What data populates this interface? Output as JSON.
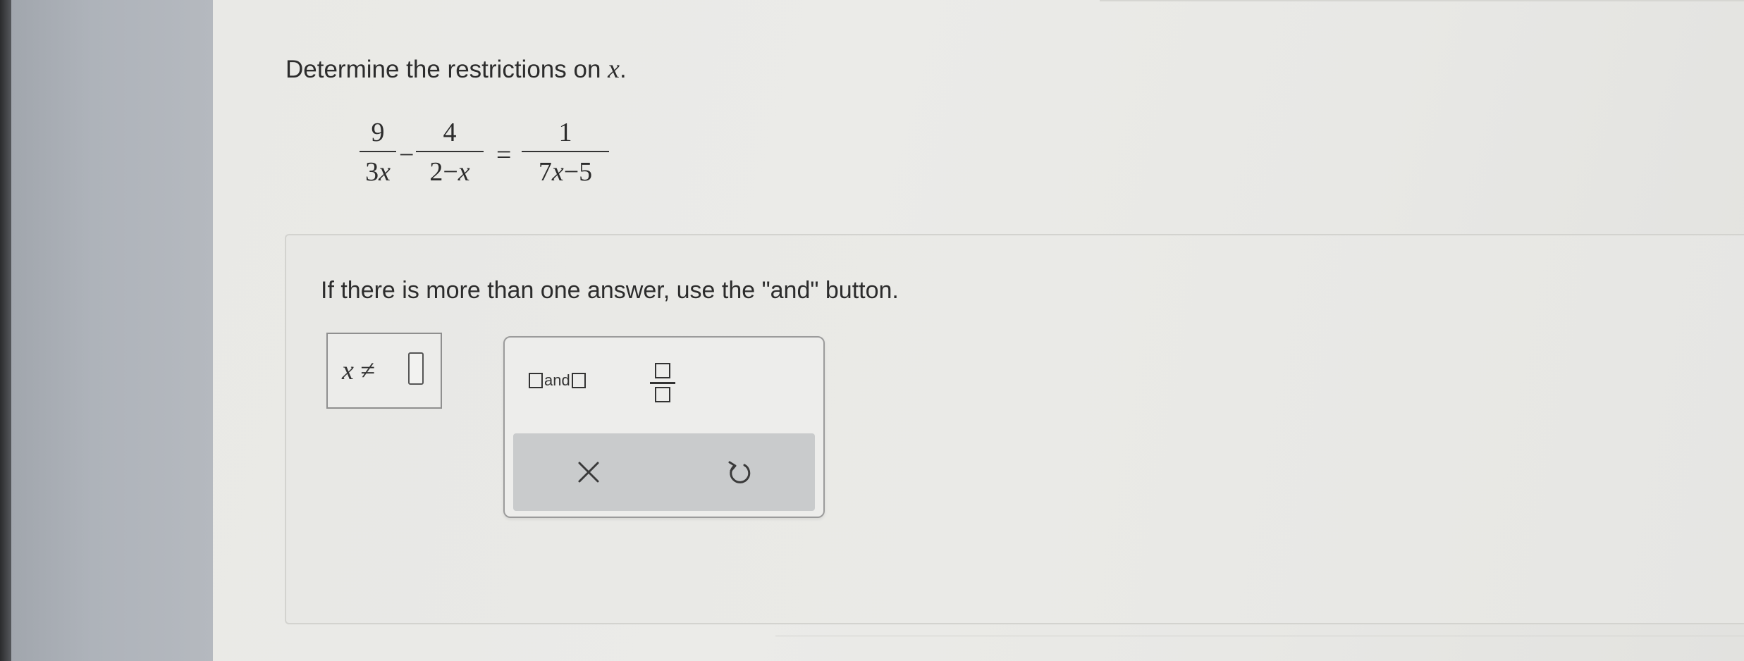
{
  "question": {
    "prompt_text": "Determine the restrictions on ",
    "prompt_variable": "x",
    "prompt_period": ".",
    "equation": {
      "term1": {
        "numerator": "9",
        "denominator_coef": "3",
        "denominator_var": "x"
      },
      "operator1": "−",
      "term2": {
        "numerator": "4",
        "denominator_left": "2−",
        "denominator_var": "x"
      },
      "equals": "=",
      "term3": {
        "numerator": "1",
        "denominator_coef": "7",
        "denominator_var": "x",
        "denominator_right": "−5"
      }
    }
  },
  "answer_panel": {
    "instruction": "If there is more than one answer, use the \"and\" button.",
    "answer_label_var": "x",
    "answer_label_symbol": " ≠",
    "answer_value": ""
  },
  "palette": {
    "and_label": "and",
    "icons": {
      "and": "and-template-icon",
      "fraction": "fraction-template-icon",
      "clear": "clear-x-icon",
      "reset": "undo-reset-icon"
    }
  }
}
